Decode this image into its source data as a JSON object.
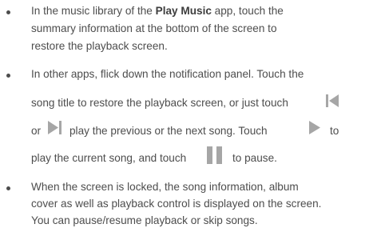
{
  "bullets": [
    {
      "lines": [
        {
          "pre": "In the music library of the ",
          "bold": "Play Music",
          "post": " app, touch the"
        },
        {
          "text": "summary information at the bottom of the screen to"
        },
        {
          "text": "restore the playback screen."
        }
      ]
    },
    {
      "lines": [
        {
          "text": "In other apps, flick down the notification panel. Touch the"
        },
        {
          "text": "song title to restore the playback screen, or just touch"
        },
        {
          "pre": "or",
          "post": "play the previous or the next song. Touch",
          "tail": "to"
        },
        {
          "pre": "play the current song, and touch",
          "post": "to pause."
        }
      ]
    },
    {
      "lines": [
        {
          "text": "When the screen is locked, the song information, album"
        },
        {
          "text": "cover as well as playback control is displayed on the screen."
        },
        {
          "text": "You can pause/resume playback or skip songs."
        }
      ]
    }
  ],
  "icons": {
    "previous": "skip-previous-icon",
    "next": "skip-next-icon",
    "play": "play-icon",
    "pause": "pause-icon",
    "color": "#a6a6a6"
  }
}
